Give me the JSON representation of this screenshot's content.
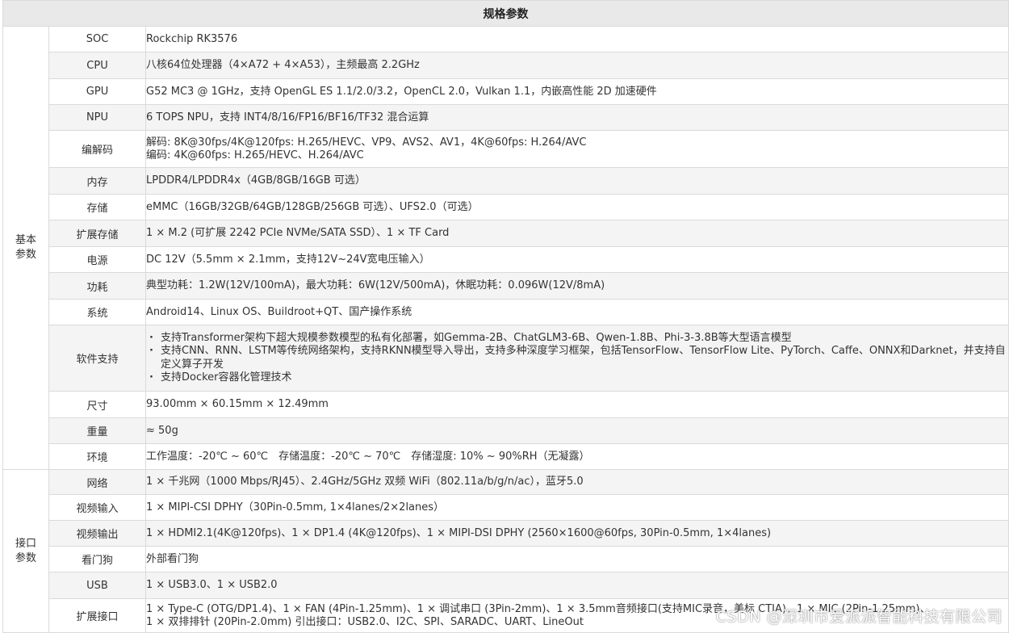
{
  "title": "规格参数",
  "groups": {
    "basic": "基本\n参数",
    "interface": "接口\n参数"
  },
  "rows": [
    {
      "label": "SOC",
      "value": "Rockchip RK3576"
    },
    {
      "label": "CPU",
      "value": "八核64位处理器（4×A72 + 4×A53），主频最高 2.2GHz"
    },
    {
      "label": "GPU",
      "value": "G52 MC3 @ 1GHz，支持 OpenGL ES 1.1/2.0/3.2，OpenCL 2.0，Vulkan 1.1，内嵌高性能 2D 加速硬件"
    },
    {
      "label": "NPU",
      "value": "6 TOPS NPU，支持 INT4/8/16/FP16/BF16/TF32 混合运算"
    },
    {
      "label": "编解码",
      "lines": [
        "解码: 8K@30fps/4K@120fps: H.265/HEVC、VP9、AVS2、AV1，4K@60fps: H.264/AVC",
        "编码: 4K@60fps: H.265/HEVC、H.264/AVC"
      ]
    },
    {
      "label": "内存",
      "value": "LPDDR4/LPDDR4x（4GB/8GB/16GB 可选）"
    },
    {
      "label": "存储",
      "value": "eMMC（16GB/32GB/64GB/128GB/256GB 可选）、UFS2.0（可选）"
    },
    {
      "label": "扩展存储",
      "value": "1 × M.2 (可扩展 2242 PCIe NVMe/SATA SSD）、1 × TF Card"
    },
    {
      "label": "电源",
      "value": "DC 12V（5.5mm × 2.1mm，支持12V~24V宽电压输入）"
    },
    {
      "label": "功耗",
      "value": "典型功耗：1.2W(12V/100mA)，最大功耗：6W(12V/500mA)，休眠功耗：0.096W(12V/8mA)"
    },
    {
      "label": "系统",
      "value": "Android14、Linux OS、Buildroot+QT、国产操作系统"
    },
    {
      "label": "软件支持",
      "bullets": [
        "支持Transformer架构下超大规模参数模型的私有化部署，如Gemma-2B、ChatGLM3-6B、Qwen-1.8B、Phi-3-3.8B等大型语言模型",
        "支持CNN、RNN、LSTM等传统网络架构，支持RKNN模型导入导出，支持多种深度学习框架，包括TensorFlow、TensorFlow Lite、PyTorch、Caffe、ONNX和Darknet，并支持自定义算子开发",
        "支持Docker容器化管理技术"
      ]
    },
    {
      "label": "尺寸",
      "value": "93.00mm × 60.15mm × 12.49mm"
    },
    {
      "label": "重量",
      "value": "≈ 50g"
    },
    {
      "label": "环境",
      "value": "工作温度：-20℃ ~ 60℃　存储温度：-20℃ ~ 70℃　存储湿度: 10% ~ 90%RH（无凝露）"
    },
    {
      "label": "网络",
      "value": "1 × 千兆网（1000 Mbps/RJ45）、2.4GHz/5GHz 双频 WiFi（802.11a/b/g/n/ac），蓝牙5.0"
    },
    {
      "label": "视频输入",
      "value": "1 × MIPI-CSI DPHY（30Pin-0.5mm, 1×4lanes/2×2lanes）"
    },
    {
      "label": "视频输出",
      "value": "1 × HDMI2.1(4K@120fps)、1 × DP1.4 (4K@120fps)、1 × MIPI-DSI DPHY (2560×1600@60fps, 30Pin-0.5mm, 1×4lanes)"
    },
    {
      "label": "看门狗",
      "value": "外部看门狗"
    },
    {
      "label": "USB",
      "value": "1 × USB3.0、1 × USB2.0"
    },
    {
      "label": "扩展接口",
      "lines": [
        "1 × Type-C (OTG/DP1.4)、1 × FAN (4Pin-1.25mm)、1 × 调试串口 (3Pin-2mm)、1 × 3.5mm音频接口(支持MIC录音，美标 CTIA)、1 × MIC (2Pin-1.25mm)、",
        "1 × 双排排针 (20Pin-2.0mm) 引出接口：USB2.0、I2C、SPI、SARADC、UART、LineOut"
      ]
    }
  ],
  "watermark": "CSDN @深圳市爱派派智能科技有限公司"
}
